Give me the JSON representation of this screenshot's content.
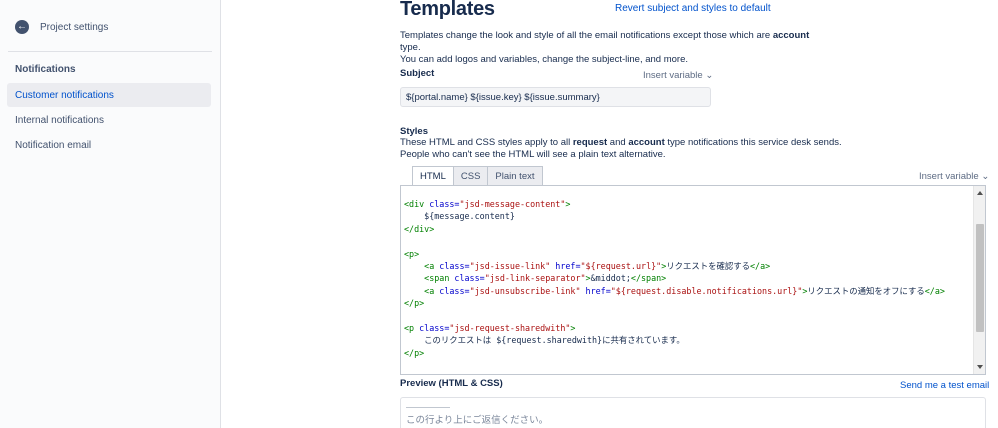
{
  "sidebar": {
    "back_label": "Project settings",
    "heading": "Notifications",
    "items": [
      {
        "label": "Customer notifications"
      },
      {
        "label": "Internal notifications"
      },
      {
        "label": "Notification email"
      }
    ]
  },
  "main": {
    "title": "Templates",
    "revert_link": "Revert subject and styles to default",
    "desc_line1_a": "Templates change the look and style of all the email notifications except those which are ",
    "desc_line1_b": "account",
    "desc_line1_c": " type.",
    "desc_line2": "You can add logos and variables, change the subject-line, and more.",
    "subject": {
      "label": "Subject",
      "insert_variable": "Insert variable",
      "value": "${portal.name} ${issue.key} ${issue.summary}"
    },
    "styles": {
      "label": "Styles",
      "desc_a": "These HTML and CSS styles apply to all ",
      "desc_b": "request",
      "desc_c": " and ",
      "desc_d": "account",
      "desc_e": " type notifications this service desk sends.",
      "desc_line2": "People who can't see the HTML will see a plain text alternative.",
      "insert_variable": "Insert variable",
      "tabs": [
        {
          "label": "HTML"
        },
        {
          "label": "CSS"
        },
        {
          "label": "Plain text"
        }
      ]
    },
    "code": {
      "l1_tag_open": "<div ",
      "l1_attr": "class=",
      "l1_str": "\"jsd-message-content\"",
      "l1_close": ">",
      "l2": "    ${message.content}",
      "l3": "</div>",
      "l5": "<p>",
      "l6_tag": "    <a ",
      "l6_attr1": "class=",
      "l6_str1": "\"jsd-issue-link\"",
      "l6_attr2": " href=",
      "l6_str2": "\"${request.url}\"",
      "l6_gt": ">",
      "l6_text": "リクエストを確認する",
      "l6_end": "</a>",
      "l7_tag": "    <span ",
      "l7_attr": "class=",
      "l7_str": "\"jsd-link-separator\"",
      "l7_gt": ">",
      "l7_text": "&middot;",
      "l7_end": "</span>",
      "l8_tag": "    <a ",
      "l8_attr1": "class=",
      "l8_str1": "\"jsd-unsubscribe-link\"",
      "l8_attr2": " href=",
      "l8_str2": "\"${request.disable.notifications.url}\"",
      "l8_gt": ">",
      "l8_text": "リクエストの通知をオフにする",
      "l8_end": "</a>",
      "l9": "</p>",
      "l11_tag": "<p ",
      "l11_attr": "class=",
      "l11_str": "\"jsd-request-sharedwith\"",
      "l11_gt": ">",
      "l12": "    このリクエストは ${request.sharedwith}に共有されています。",
      "l13": "</p>"
    },
    "preview": {
      "label": "Preview (HTML & CSS)",
      "send_test": "Send me a test email",
      "text": "この行より上にご返信ください。"
    }
  }
}
